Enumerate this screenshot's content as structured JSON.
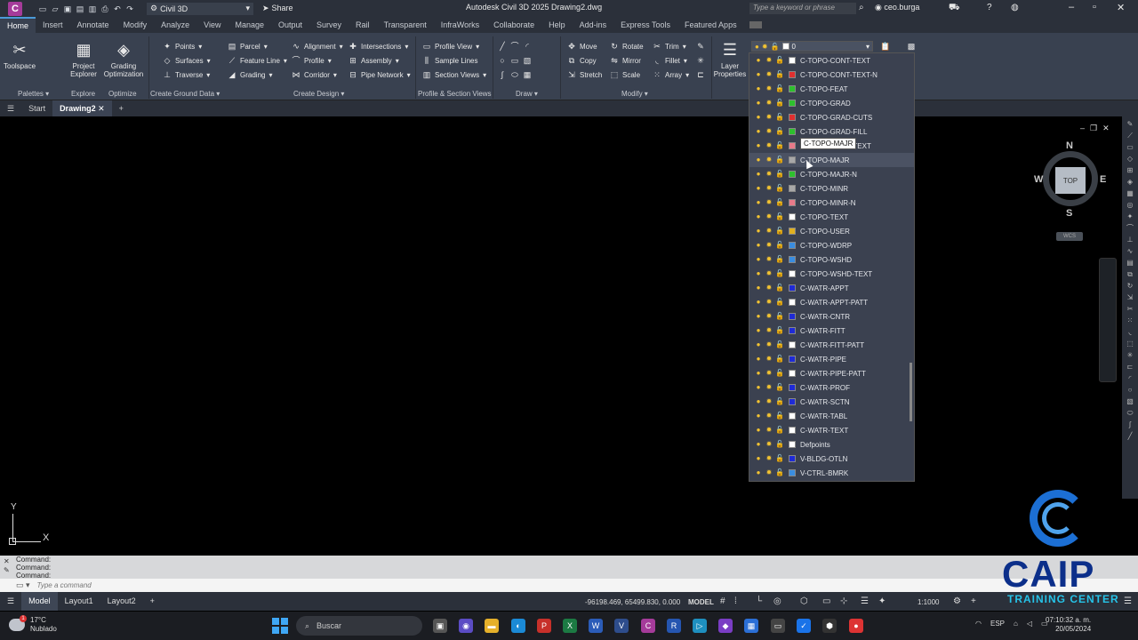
{
  "titlebar": {
    "app_letter": "C",
    "workspace": "Civil 3D",
    "share": "Share",
    "title": "Autodesk Civil 3D 2025    Drawing2.dwg",
    "search_placeholder": "Type a keyword or phrase",
    "user": "ceo.burga"
  },
  "tabs": [
    "Home",
    "Insert",
    "Annotate",
    "Modify",
    "Analyze",
    "View",
    "Manage",
    "Output",
    "Survey",
    "Rail",
    "Transparent",
    "InfraWorks",
    "Collaborate",
    "Help",
    "Add-ins",
    "Express Tools",
    "Featured Apps"
  ],
  "ribbon": {
    "toolspace": "Toolspace",
    "project_explorer": "Project Explorer",
    "grading_optimization": "Grading Optimization",
    "points": "Points",
    "surfaces": "Surfaces",
    "traverse": "Traverse",
    "parcel": "Parcel",
    "feature_line": "Feature Line",
    "grading": "Grading",
    "alignment": "Alignment",
    "profile": "Profile",
    "corridor": "Corridor",
    "intersections": "Intersections",
    "assembly": "Assembly",
    "pipe_network": "Pipe Network",
    "profile_view": "Profile View",
    "sample_lines": "Sample Lines",
    "section_views": "Section Views",
    "move": "Move",
    "copy": "Copy",
    "stretch": "Stretch",
    "rotate": "Rotate",
    "mirror": "Mirror",
    "scale": "Scale",
    "trim": "Trim",
    "fillet": "Fillet",
    "array": "Array",
    "layer_properties": "Layer Properties",
    "current_layer": "0",
    "panels": {
      "palettes": "Palettes",
      "explore": "Explore",
      "optimize": "Optimize",
      "create_ground_data": "Create Ground Data",
      "create_design": "Create Design",
      "profile_section": "Profile & Section Views",
      "draw": "Draw",
      "modify": "Modify"
    }
  },
  "doctabs": [
    "Start",
    "Drawing2"
  ],
  "viewcube": {
    "top": "TOP",
    "n": "N",
    "s": "S",
    "e": "E",
    "w": "W",
    "wcs": "WCS"
  },
  "ucs": {
    "y": "Y",
    "x": "X"
  },
  "layers": [
    {
      "name": "C-TOPO-CONT-TEXT",
      "color": "#ffffff"
    },
    {
      "name": "C-TOPO-CONT-TEXT-N",
      "color": "#e03030"
    },
    {
      "name": "C-TOPO-FEAT",
      "color": "#2ec02e"
    },
    {
      "name": "C-TOPO-GRAD",
      "color": "#2ec02e"
    },
    {
      "name": "C-TOPO-GRAD-CUTS",
      "color": "#e03030"
    },
    {
      "name": "C-TOPO-GRAD-FILL",
      "color": "#2ec02e"
    },
    {
      "name": "C-TOPO-GRAD-TEXT",
      "color": "#e87a8a"
    },
    {
      "name": "C-TOPO-MAJR",
      "color": "#a8a8a8"
    },
    {
      "name": "C-TOPO-MAJR-N",
      "color": "#2ec02e"
    },
    {
      "name": "C-TOPO-MINR",
      "color": "#a8a8a8"
    },
    {
      "name": "C-TOPO-MINR-N",
      "color": "#e87a8a"
    },
    {
      "name": "C-TOPO-TEXT",
      "color": "#ffffff"
    },
    {
      "name": "C-TOPO-USER",
      "color": "#e0b020"
    },
    {
      "name": "C-TOPO-WDRP",
      "color": "#3a8de0"
    },
    {
      "name": "C-TOPO-WSHD",
      "color": "#3a8de0"
    },
    {
      "name": "C-TOPO-WSHD-TEXT",
      "color": "#ffffff"
    },
    {
      "name": "C-WATR-APPT",
      "color": "#1f2bd6"
    },
    {
      "name": "C-WATR-APPT-PATT",
      "color": "#ffffff"
    },
    {
      "name": "C-WATR-CNTR",
      "color": "#1f2bd6"
    },
    {
      "name": "C-WATR-FITT",
      "color": "#1f2bd6"
    },
    {
      "name": "C-WATR-FITT-PATT",
      "color": "#ffffff"
    },
    {
      "name": "C-WATR-PIPE",
      "color": "#1f2bd6"
    },
    {
      "name": "C-WATR-PIPE-PATT",
      "color": "#ffffff"
    },
    {
      "name": "C-WATR-PROF",
      "color": "#1f2bd6"
    },
    {
      "name": "C-WATR-SCTN",
      "color": "#1f2bd6"
    },
    {
      "name": "C-WATR-TABL",
      "color": "#ffffff"
    },
    {
      "name": "C-WATR-TEXT",
      "color": "#ffffff"
    },
    {
      "name": "Defpoints",
      "color": "#ffffff"
    },
    {
      "name": "V-BLDG-OTLN",
      "color": "#1f2bd6"
    },
    {
      "name": "V-CTRL-BMRK",
      "color": "#3a8de0"
    }
  ],
  "tooltip": "C-TOPO-MAJR",
  "command": {
    "history": [
      "Command:",
      "Command:",
      "Command:"
    ],
    "placeholder": "Type a command"
  },
  "status": {
    "tabs": [
      "Model",
      "Layout1",
      "Layout2"
    ],
    "coords": "-96198.469, 65499.830, 0.000",
    "mode": "MODEL",
    "scale": "1:1000",
    "lang": "ESP"
  },
  "taskbar": {
    "temp": "17°C",
    "weather": "Nublado",
    "badge": "1",
    "search": "Buscar",
    "time": "07:10:32 a. m.",
    "date": "20/05/2024"
  },
  "watermark": {
    "title": "CAIP",
    "subtitle": "TRAINING CENTER"
  }
}
